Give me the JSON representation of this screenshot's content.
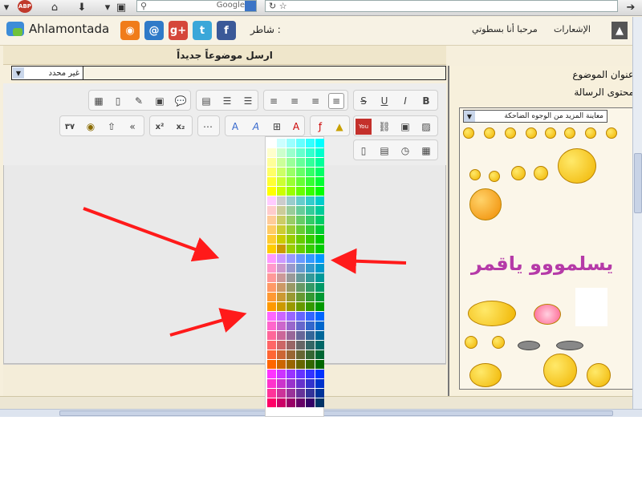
{
  "browser": {
    "search_engine": "Google",
    "abp_badge": "ABP"
  },
  "forum_bar": {
    "site_name": "Ahlamontada",
    "share_label": "شاطر :",
    "welcome": "مرحبا أنا بسطوتي",
    "notifications": "الإشعارات",
    "social_icons": [
      "rss-icon",
      "email-icon",
      "googleplus-icon",
      "twitter-icon",
      "facebook-icon"
    ]
  },
  "post": {
    "header": "ارسل موضوعاً جديداً",
    "subject_select_value": "غير محدد",
    "subject_label": "عنوان الموضوع",
    "message_label": "محتوى الرسالة",
    "smileys_select": "معاينة المزيد من الوجوه الضاحكة",
    "smiley_text": "يسلمووو ياقمر"
  },
  "colors": {
    "arrow": "#ff1a1a",
    "palette": [
      [
        "#ffffff",
        "#ccffff",
        "#99ffff",
        "#66ffff",
        "#33ffff",
        "#00ffff"
      ],
      [
        "#ffffcc",
        "#ccffcc",
        "#99ffcc",
        "#66ffcc",
        "#33ffcc",
        "#00ffcc"
      ],
      [
        "#ffff99",
        "#ccff99",
        "#99ff99",
        "#66ff99",
        "#33ff99",
        "#00ff99"
      ],
      [
        "#ffff66",
        "#ccff66",
        "#99ff66",
        "#66ff66",
        "#33ff66",
        "#00ff66"
      ],
      [
        "#ffff33",
        "#ccff33",
        "#99ff33",
        "#66ff33",
        "#33ff33",
        "#00ff33"
      ],
      [
        "#ffff00",
        "#ccff00",
        "#99ff00",
        "#66ff00",
        "#33ff00",
        "#00ff00"
      ],
      [
        "#ffccff",
        "#cccccc",
        "#99cccc",
        "#66cccc",
        "#33cccc",
        "#00cccc"
      ],
      [
        "#ffcccc",
        "#cccc99",
        "#99cc99",
        "#66cc99",
        "#33cc99",
        "#00cc99"
      ],
      [
        "#ffcc99",
        "#cccc66",
        "#99cc66",
        "#66cc66",
        "#33cc66",
        "#00cc66"
      ],
      [
        "#ffcc66",
        "#cccc33",
        "#99cc33",
        "#66cc33",
        "#33cc33",
        "#00cc33"
      ],
      [
        "#ffcc33",
        "#cccc00",
        "#99cc00",
        "#66cc00",
        "#33cc00",
        "#00cc00"
      ],
      [
        "#ffcc00",
        "#cc9900",
        "#99cc00",
        "#66cc00",
        "#33cc00",
        "#00cc00"
      ],
      [
        "#ff99ff",
        "#cc99ff",
        "#9999ff",
        "#6699ff",
        "#3399ff",
        "#0099ff"
      ],
      [
        "#ff99cc",
        "#cc99cc",
        "#9999cc",
        "#6699cc",
        "#3399cc",
        "#0099cc"
      ],
      [
        "#ff9999",
        "#cc9999",
        "#999999",
        "#669999",
        "#339999",
        "#009999"
      ],
      [
        "#ff9966",
        "#cc9966",
        "#999966",
        "#669966",
        "#339966",
        "#009966"
      ],
      [
        "#ff9933",
        "#cc9933",
        "#999933",
        "#669933",
        "#339933",
        "#009933"
      ],
      [
        "#ff9900",
        "#cc9900",
        "#999900",
        "#669900",
        "#339900",
        "#009900"
      ],
      [
        "#ff66ff",
        "#cc66ff",
        "#9966ff",
        "#6666ff",
        "#3366ff",
        "#0066ff"
      ],
      [
        "#ff66cc",
        "#cc66cc",
        "#9966cc",
        "#6666cc",
        "#3366cc",
        "#0066cc"
      ],
      [
        "#ff6699",
        "#cc6699",
        "#996699",
        "#666699",
        "#336699",
        "#006699"
      ],
      [
        "#ff6666",
        "#cc6666",
        "#996666",
        "#666666",
        "#336666",
        "#006666"
      ],
      [
        "#ff6633",
        "#cc6633",
        "#996633",
        "#666633",
        "#336633",
        "#006633"
      ],
      [
        "#ff6600",
        "#cc6600",
        "#996600",
        "#666600",
        "#336600",
        "#006600"
      ],
      [
        "#ff33ff",
        "#cc33ff",
        "#9933ff",
        "#6633ff",
        "#3333ff",
        "#0033ff"
      ],
      [
        "#ff33cc",
        "#cc33cc",
        "#9933cc",
        "#6633cc",
        "#3333cc",
        "#0033cc"
      ],
      [
        "#ff3399",
        "#cc3399",
        "#993399",
        "#663399",
        "#333399",
        "#003399"
      ],
      [
        "#ff0066",
        "#cc0066",
        "#990066",
        "#660066",
        "#330066",
        "#003366"
      ]
    ]
  },
  "toolbar": {
    "row1": [
      "bold",
      "underline",
      "italic",
      "strikethrough",
      "align-left",
      "align-center",
      "align-right",
      "justify",
      "bullet-list",
      "number-list",
      "horizontal-rule",
      "quote",
      "image-link",
      "flash",
      "edit",
      "insert-table"
    ],
    "row2": [
      "subscript",
      "superscript",
      "more",
      "color-pick",
      "font-color",
      "font-grid",
      "font-size",
      "flash-object",
      "youtube",
      "link",
      "image",
      "image-gallery",
      "undo",
      "redo",
      "clear",
      "symbol"
    ],
    "row3": [
      "doc",
      "paste",
      "clock",
      "calendar"
    ]
  }
}
